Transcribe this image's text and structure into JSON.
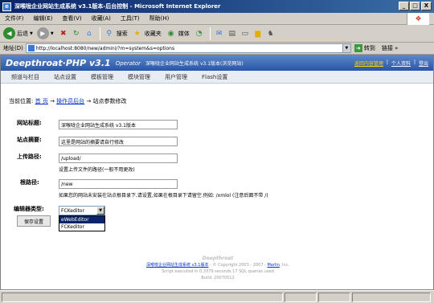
{
  "window": {
    "title": "深喉咙企业网站生成系统 v3.1版本-后台控制 - Microsoft Internet Explorer",
    "buttons": [
      "_",
      "□",
      "X"
    ]
  },
  "menu": [
    "文件(F)",
    "编辑(E)",
    "查看(V)",
    "收藏(A)",
    "工具(T)",
    "帮助(H)"
  ],
  "toolbar": {
    "back": "后退",
    "search": "搜索",
    "favorites": "收藏夹",
    "media": "媒体"
  },
  "address": {
    "label": "地址(D)",
    "url": "http://localhost:8080/new/admini/?m=system&s=options",
    "go": "转到",
    "links": "链接 »"
  },
  "header": {
    "brand": "Deepthroat·PHP v3.1",
    "operator": "Operator",
    "info": "深喉咙企业网站生成系统 v3.1版本(",
    "info_link": "浏览网站",
    "info_end": ")",
    "right_link1": "返回内容管理",
    "right_link2": "个人资料",
    "right_link3": "登出"
  },
  "nav": [
    "频道与栏目",
    "站点设置",
    "模板管理",
    "模块管理",
    "用户管理",
    "Flash设置"
  ],
  "breadcrumb": {
    "prefix": "当前位置:",
    "home": "首 页",
    "arrow1": "→",
    "console": "操作员后台",
    "arrow2": "→",
    "current": "站点参数修改"
  },
  "form": {
    "site_title_label": "网站标题:",
    "site_title_value": "深喉咙企业网站生成系统 v3.1版本",
    "site_desc_label": "站点摘要:",
    "site_desc_value": "这里是网站的摘要请自行修改",
    "upload_label": "上传路径:",
    "upload_value": "/upload/",
    "upload_hint": "设置上传文件的路径(一般不用更改)",
    "root_label": "根路径:",
    "root_value": "/new",
    "root_hint": "如果您的网站未安装在站点根目录下,请设置,如果在根目录下请留空.例如: /xmlol (注意后面不带 /)",
    "editor_label": "编辑器类型:",
    "editor_selected": "FCKeditor",
    "editor_options": [
      "eWebEditor",
      "FCKeditor"
    ],
    "save_button": "保存设置"
  },
  "footer": {
    "brand": "Deepthroat",
    "line1_link": "深喉咙企业网站生成系统 v3.1版本",
    "line1_mid": " - © Copyright 2003 - 2007 - ",
    "line1_author": "Marlin",
    "line1_end": ", Inc.",
    "line2": "Script executed in 0.3379 seconds 17 SQL queries used",
    "line3": "Build: 20070512"
  },
  "colors": {
    "title_bar": "#0a246a",
    "header_bg": "#2855a8",
    "link": "#0033cc",
    "highlight": "#ffd800",
    "option_selected": "#0a246a"
  }
}
